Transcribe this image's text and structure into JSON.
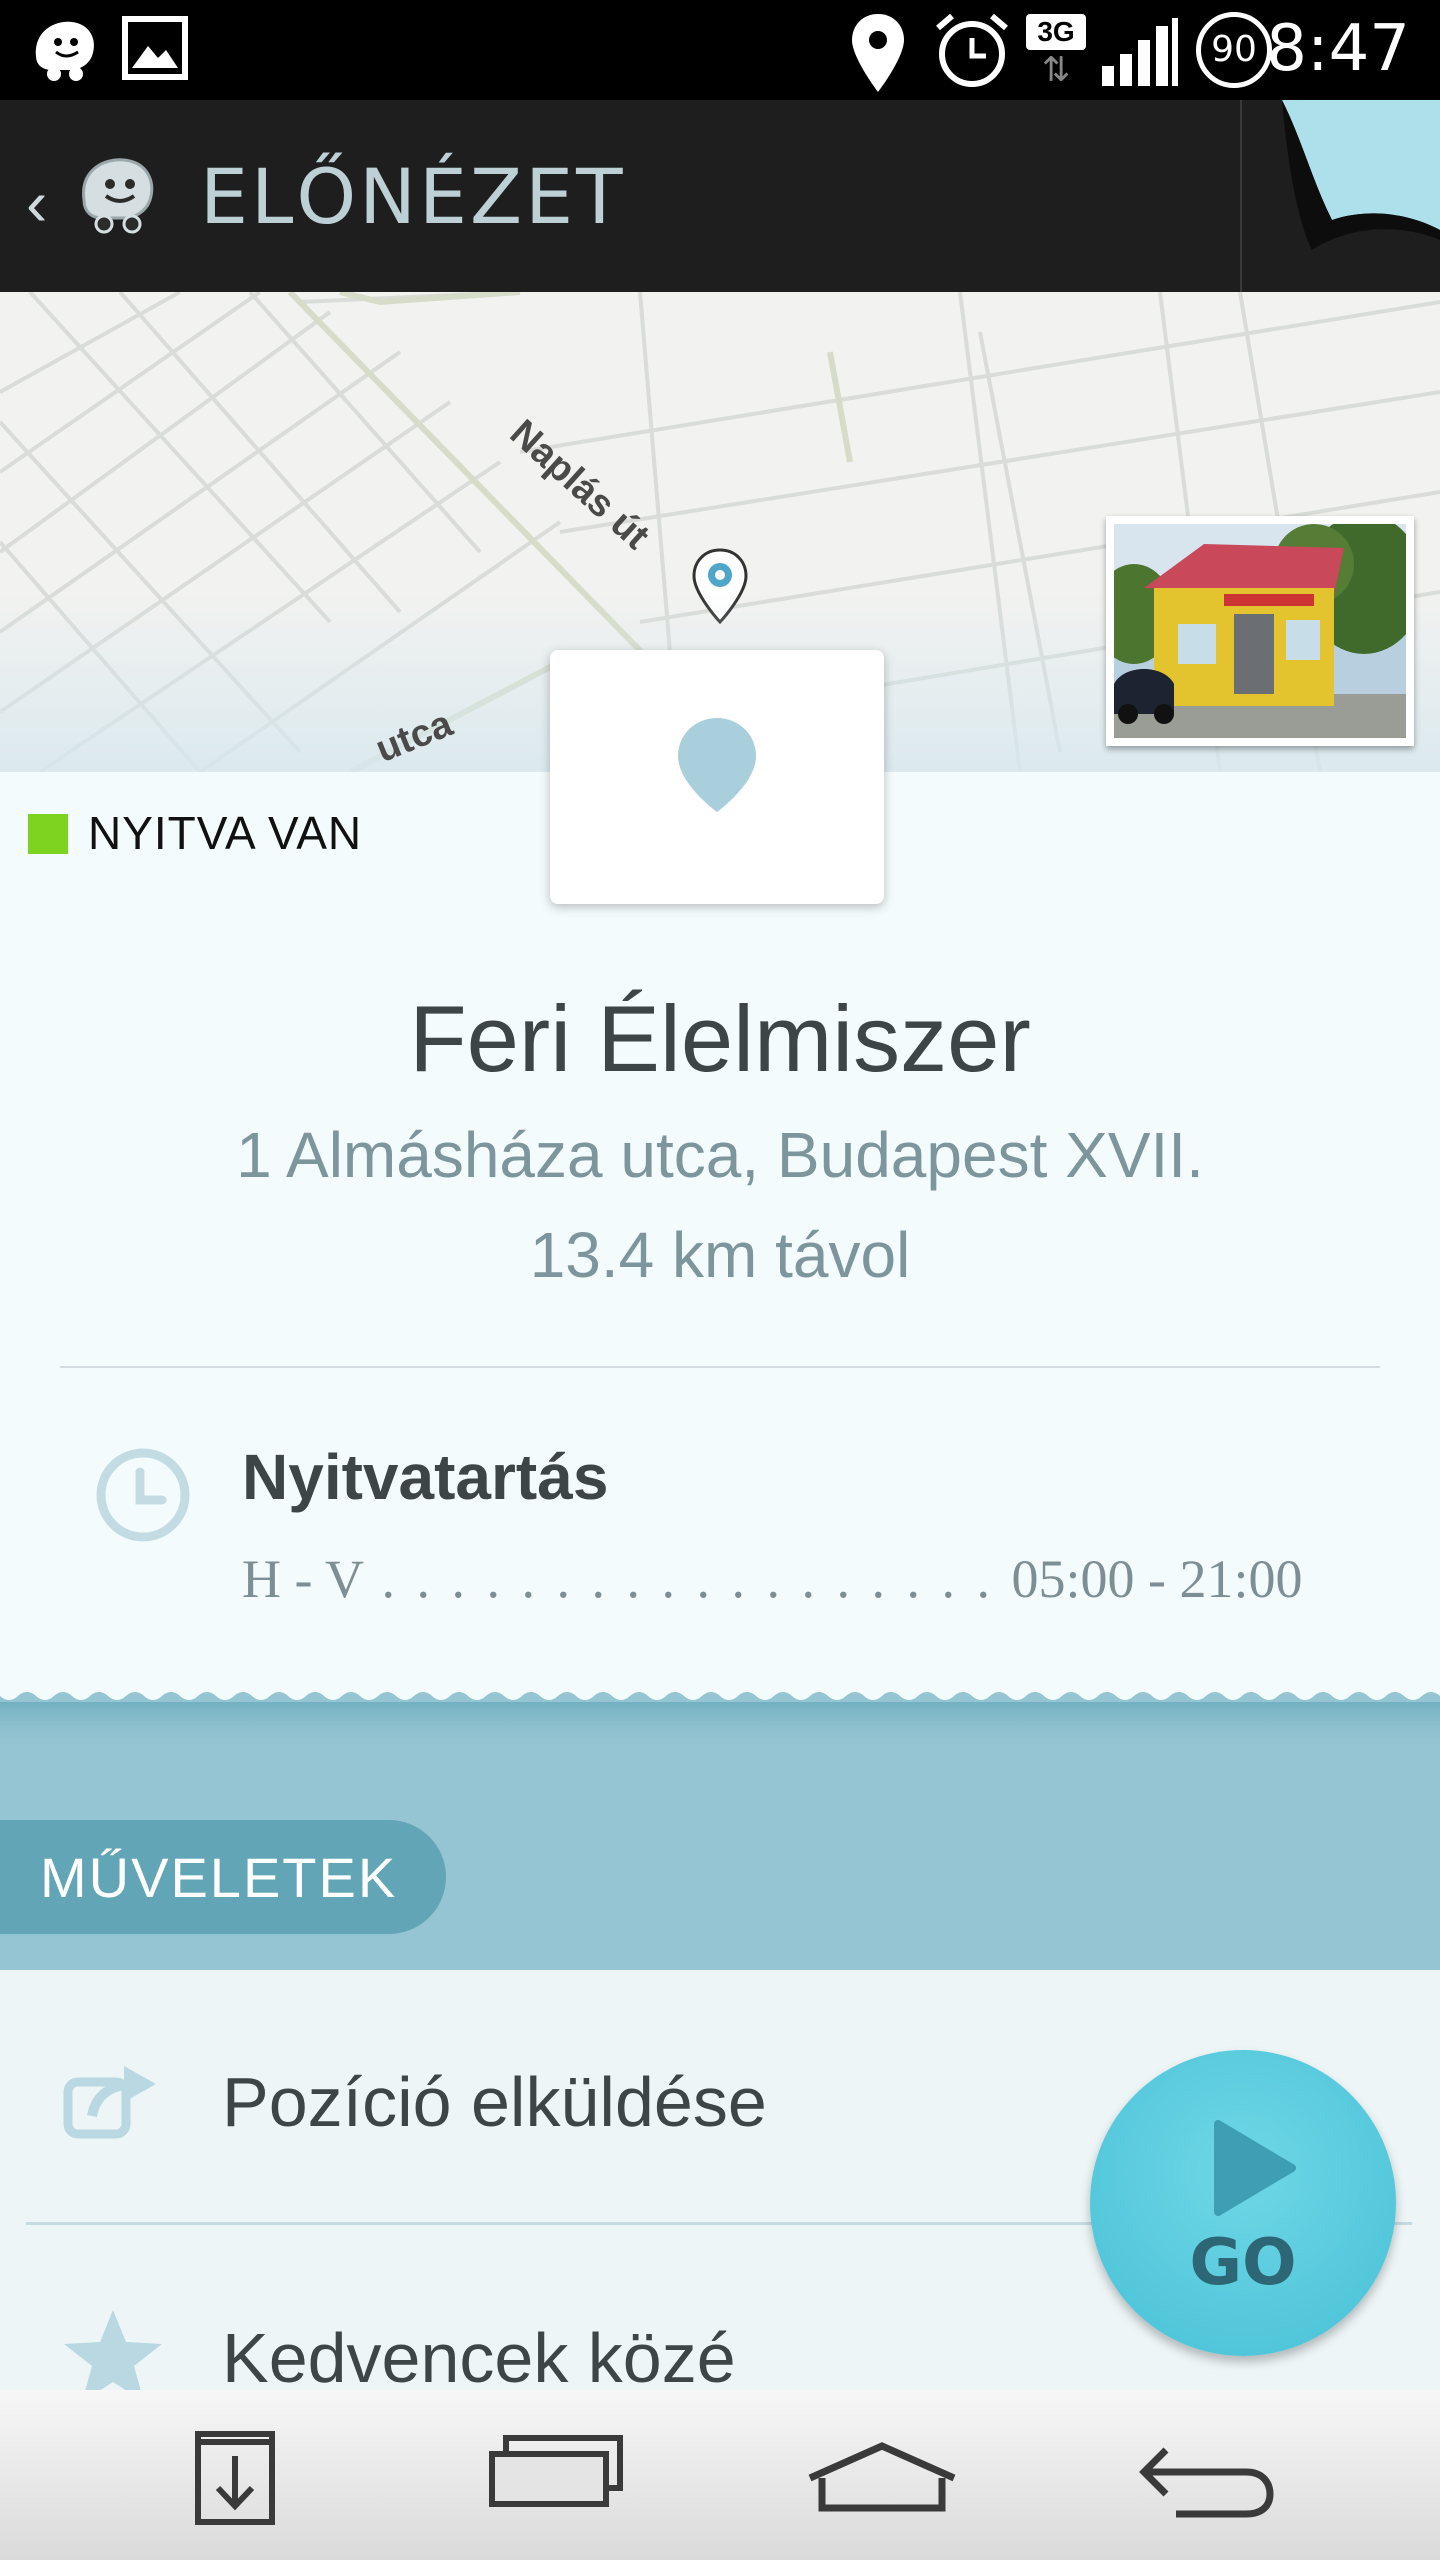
{
  "status_bar": {
    "time": "8:47",
    "network": "3G",
    "battery": "90",
    "icons": [
      "waze-icon",
      "image-icon",
      "location-icon",
      "alarm-icon",
      "network-3g-icon",
      "signal-icon",
      "battery-icon"
    ]
  },
  "app_bar": {
    "title": "ELŐNÉZET"
  },
  "map": {
    "street_1": "Naplás út",
    "street_2": "utca"
  },
  "place": {
    "status": "NYITVA VAN",
    "name": "Feri Élelmiszer",
    "address": "1 Almásháza utca, Budapest XVII.",
    "distance": "13.4 km távol"
  },
  "hours": {
    "title": "Nyitvatartás",
    "days": "H - V",
    "dots": " . . . . . . . . . . . . . . . . . . ",
    "time": "05:00 - 21:00"
  },
  "actions": {
    "section_label": "MŰVELETEK",
    "items": [
      {
        "label": "Pozíció elküldése",
        "icon": "share-icon"
      },
      {
        "label": "Kedvencek közé",
        "icon": "star-icon"
      }
    ]
  },
  "go_button": {
    "label": "GO"
  },
  "colors": {
    "open_status": "#7ed321",
    "accent": "#47c0d6",
    "band": "#95c4d2"
  }
}
